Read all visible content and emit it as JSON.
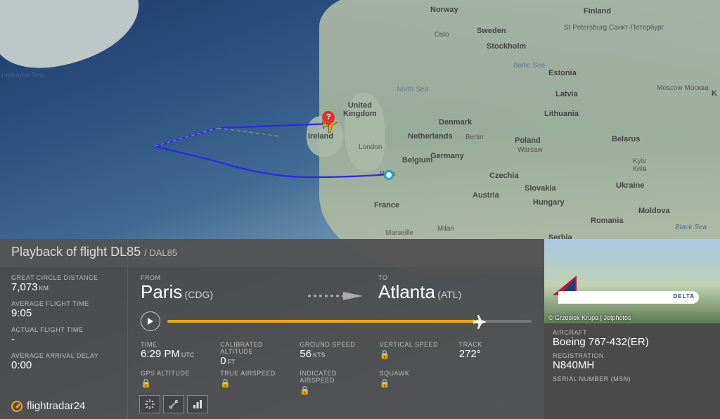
{
  "title": {
    "prefix": "Playback of flight",
    "flight": "DL85",
    "callsign": "/ DAL85"
  },
  "left_metrics": {
    "gcd_label": "GREAT CIRCLE DISTANCE",
    "gcd_value": "7,073",
    "gcd_unit": "KM",
    "avgtime_label": "AVERAGE FLIGHT TIME",
    "avgtime_value": "9:05",
    "acttime_label": "ACTUAL FLIGHT TIME",
    "acttime_value": "-",
    "delay_label": "AVERAGE ARRIVAL DELAY",
    "delay_value": "0:00"
  },
  "brand": "flightradar24",
  "route": {
    "from_label": "FROM",
    "from_city": "Paris",
    "from_code": "(CDG)",
    "to_label": "TO",
    "to_city": "Atlanta",
    "to_code": "(ATL)"
  },
  "readouts": {
    "time_label": "TIME",
    "time_value": "6:29 PM",
    "time_unit": "UTC",
    "calalt_label": "CALIBRATED ALTITUDE",
    "calalt_value": "0",
    "calalt_unit": "FT",
    "gs_label": "GROUND SPEED",
    "gs_value": "56",
    "gs_unit": "KTS",
    "vs_label": "VERTICAL SPEED",
    "trk_label": "TRACK",
    "trk_value": "272°",
    "gpsalt_label": "GPS ALTITUDE",
    "tas_label": "TRUE AIRSPEED",
    "ias_label": "INDICATED AIRSPEED",
    "sqk_label": "SQUAWK"
  },
  "aircraft": {
    "photo_credit": "© Grzesiek Krupa | Jetphotos",
    "type_label": "AIRCRAFT",
    "type_value": "Boeing 767-432(ER)",
    "reg_label": "REGISTRATION",
    "reg_value": "N840MH",
    "msn_label": "SERIAL NUMBER (MSN)",
    "brand_text": "DELTA"
  },
  "map_labels": {
    "labrador": "Labrador Sea",
    "northsea": "North Sea",
    "baltic": "Baltic Sea",
    "blacksea": "Black Sea",
    "norway": "Norway",
    "finland": "Finland",
    "sweden": "Sweden",
    "estonia": "Estonia",
    "latvia": "Latvia",
    "lithuania": "Lithuania",
    "denmark": "Denmark",
    "uk": "United\nKingdom",
    "ireland": "Ireland",
    "netherlands": "Netherlands",
    "germany": "Germany",
    "belgium": "Belgium",
    "poland": "Poland",
    "belarus": "Belarus",
    "ukraine": "Ukraine",
    "czechia": "Czechia",
    "slovakia": "Slovakia",
    "austria": "Austria",
    "hungary": "Hungary",
    "romania": "Romania",
    "moldova": "Moldova",
    "france": "France",
    "serbia": "Serbia",
    "oslo": "Oslo",
    "stockholm": "Stockholm",
    "stpetersburg": "St Petersburg\nСанкт-Петербург",
    "moscow": "Moscow\nМосква",
    "london": "London",
    "paris": "Paris",
    "berlin": "Berlin",
    "warsaw": "Warsaw",
    "kyiv": "Kyiv\nКиїв",
    "marseille": "Marseille",
    "milan": "Milan",
    "k": "K"
  }
}
